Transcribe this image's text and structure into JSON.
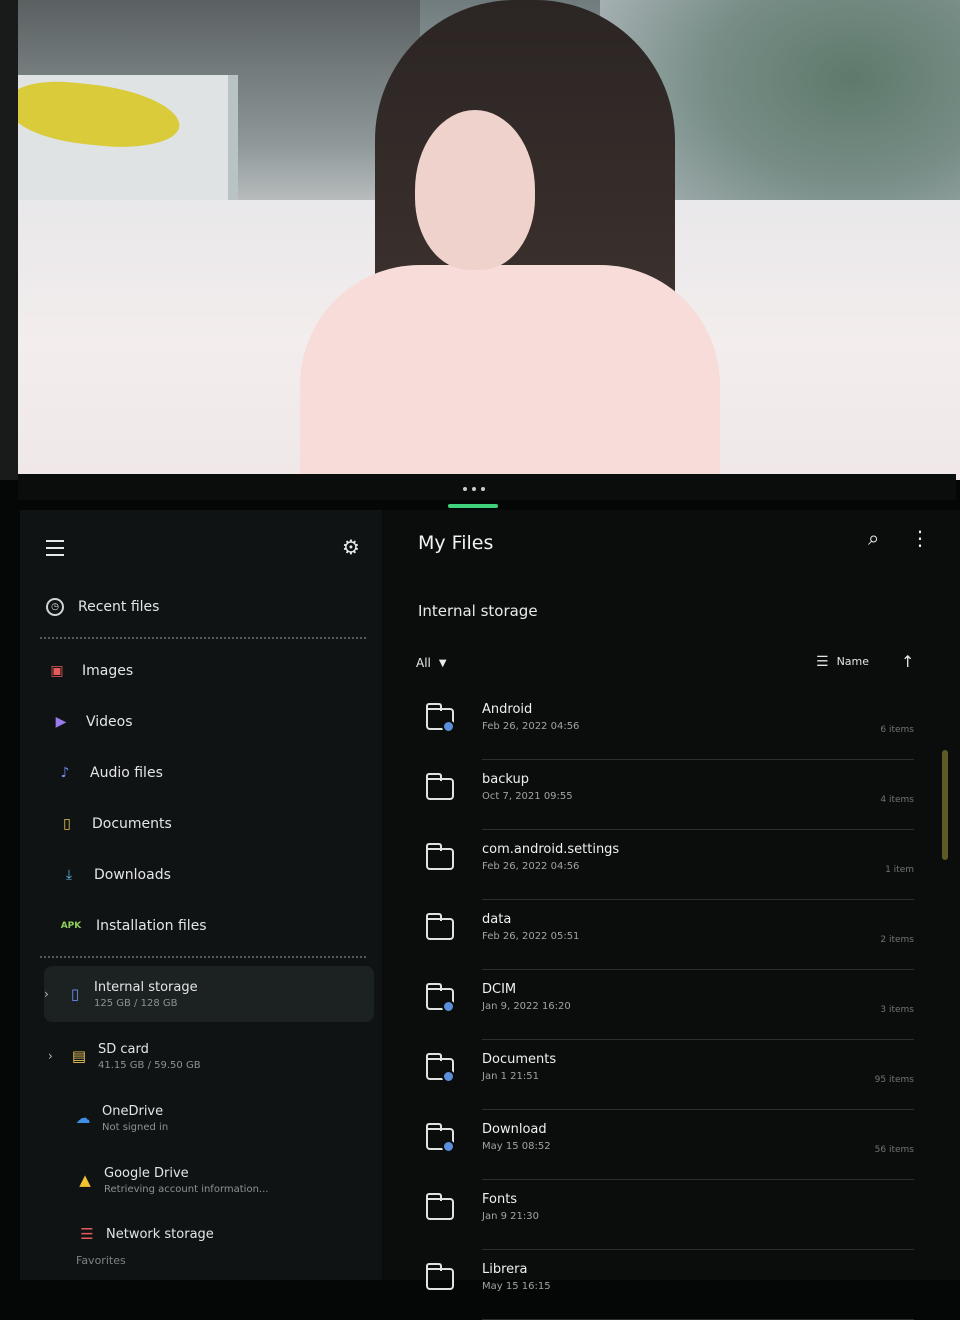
{
  "header": {
    "title": "My Files"
  },
  "drawer": {
    "recent": "Recent files",
    "categories": [
      {
        "label": "Images",
        "icon": "image-icon",
        "color": "#e65a5a"
      },
      {
        "label": "Videos",
        "icon": "video-icon",
        "color": "#9a7bea"
      },
      {
        "label": "Audio files",
        "icon": "music-note-icon",
        "color": "#6d8ef0"
      },
      {
        "label": "Documents",
        "icon": "document-icon",
        "color": "#e6c25a"
      },
      {
        "label": "Downloads",
        "icon": "download-icon",
        "color": "#5fb4e6"
      },
      {
        "label": "Installation files",
        "icon": "apk-icon",
        "color": "#8ccf5b"
      }
    ],
    "storage": [
      {
        "label": "Internal storage",
        "sub": "125 GB / 128 GB"
      },
      {
        "label": "SD card",
        "sub": "41.15 GB / 59.50 GB"
      },
      {
        "label": "OneDrive",
        "sub": "Not signed in"
      },
      {
        "label": "Google Drive",
        "sub": "Retrieving account information..."
      },
      {
        "label": "Network storage",
        "sub": ""
      }
    ],
    "favorites": "Favorites"
  },
  "main": {
    "path": "Internal storage",
    "filter": "All",
    "sort": "Name",
    "files": [
      {
        "name": "Android",
        "date": "Feb 26, 2022 04:56",
        "count": "6 items"
      },
      {
        "name": "backup",
        "date": "Oct 7, 2021 09:55",
        "count": "4 items"
      },
      {
        "name": "com.android.settings",
        "date": "Feb 26, 2022 04:56",
        "count": "1 item"
      },
      {
        "name": "data",
        "date": "Feb 26, 2022 05:51",
        "count": "2 items"
      },
      {
        "name": "DCIM",
        "date": "Jan 9, 2022 16:20",
        "count": "3 items"
      },
      {
        "name": "Documents",
        "date": "Jan 1 21:51",
        "count": "95 items"
      },
      {
        "name": "Download",
        "date": "May 15 08:52",
        "count": "56 items"
      },
      {
        "name": "Fonts",
        "date": "Jan 9 21:30",
        "count": ""
      },
      {
        "name": "Librera",
        "date": "May 15 16:15",
        "count": ""
      }
    ]
  }
}
